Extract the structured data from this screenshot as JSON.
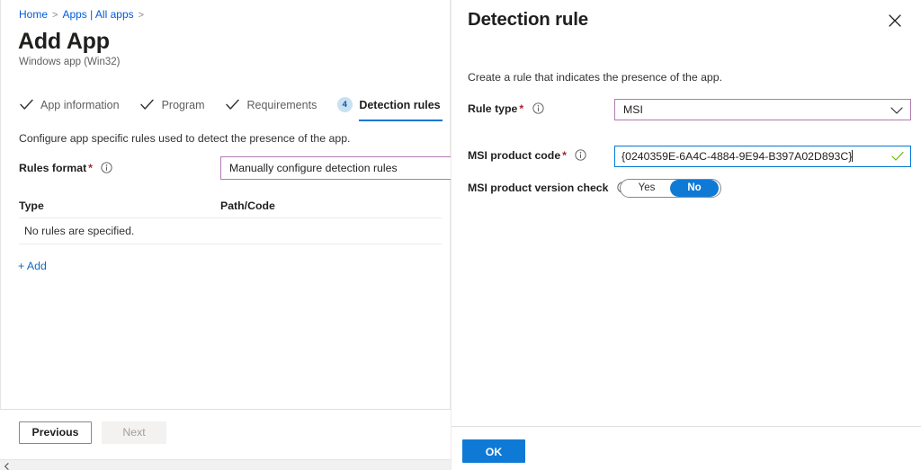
{
  "breadcrumb": {
    "items": [
      "Home",
      "Apps | All apps"
    ],
    "separator": ">"
  },
  "page": {
    "title": "Add App",
    "subtitle": "Windows app (Win32)"
  },
  "wizard": {
    "tabs": [
      {
        "label": "App information",
        "state": "completed",
        "mark": "check-icon"
      },
      {
        "label": "Program",
        "state": "completed",
        "mark": "check-icon"
      },
      {
        "label": "Requirements",
        "state": "completed",
        "mark": "check-icon"
      },
      {
        "label": "Detection rules",
        "state": "active",
        "mark": "step-badge",
        "step": "4"
      }
    ]
  },
  "main": {
    "description": "Configure app specific rules used to detect the presence of the app.",
    "rules_format": {
      "label": "Rules format",
      "required_marker": "*",
      "info_icon": "info-icon",
      "value": "Manually configure detection rules"
    },
    "table": {
      "columns": [
        "Type",
        "Path/Code"
      ],
      "empty_message": "No rules are specified."
    },
    "add_link": "+ Add",
    "footer": {
      "previous": "Previous",
      "next": "Next"
    }
  },
  "panel": {
    "title": "Detection rule",
    "close_icon": "close-icon",
    "description": "Create a rule that indicates the presence of the app.",
    "fields": {
      "rule_type": {
        "label": "Rule type",
        "required_marker": "*",
        "info_icon": "info-icon",
        "value": "MSI",
        "chevron_icon": "chevron-down-icon"
      },
      "msi_product_code": {
        "label": "MSI product code",
        "required_marker": "*",
        "info_icon": "info-icon",
        "value": "{0240359E-6A4C-4884-9E94-B397A02D893C}",
        "valid_icon": "checkmark-icon"
      },
      "msi_product_version_check": {
        "label": "MSI product version check",
        "info_icon": "info-icon",
        "options": [
          "Yes",
          "No"
        ],
        "selected": "No"
      }
    },
    "footer": {
      "ok": "OK"
    }
  },
  "colors": {
    "accent": "#0078d4",
    "ok_button": "#0f7ad6",
    "required_star": "#a4262c",
    "dropdown_border": "#b07bb0",
    "focus_border": "#0078d4",
    "link": "#0f6cbd",
    "valid_check": "#6bb700"
  },
  "scrollbar": {
    "left_arrow_icon": "caret-left-icon"
  }
}
